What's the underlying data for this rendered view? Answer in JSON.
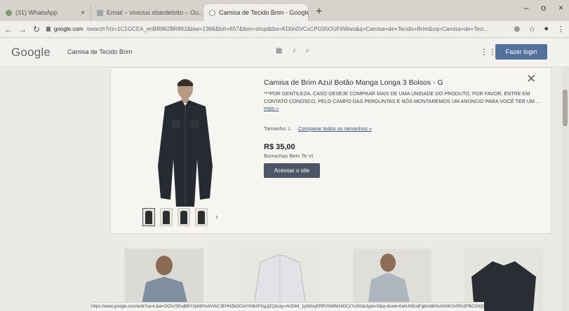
{
  "tabs": [
    {
      "label": "(31) WhatsApp",
      "close": "×"
    },
    {
      "label": "Email – vinicius sbardelotto – Ou...",
      "close": "×"
    },
    {
      "label": "Camisa de Tecido Brim - Google ...",
      "close": "×"
    }
  ],
  "new_tab_label": "+",
  "window_controls": {
    "minimize": "–",
    "maximize": "o",
    "close": "×"
  },
  "address": {
    "host": "google.com",
    "path": "/search?rlz=1C1GCEA_enBR862BR862&biw=1366&bih=657&tbm=shop&tbs=KD0n0VCxCPG95OUF6Wwo&q=Camisa+de+Tecido+Brim&oq=Camisa+de+Teci..."
  },
  "header": {
    "logo": "Google",
    "query": "Camisa de Tecido Brim",
    "login_label": "Fazer login"
  },
  "product": {
    "title": "Camisa de Brim Azul Botão Manga Longa 3 Bolsos - G",
    "description": "***POR GENTILEZA, CASO DESEJE COMPRAR MAIS DE UMA UNIDADE DO PRODUTO, POR FAVOR, ENTRE EM CONTATO CONOSCO, PELO CAMPO DAS PERGUNTAS E NÓS MONTAREMOS UM ANÚNCIO PARA VOCÊ TER UM ...",
    "more_label": "mais »",
    "size_label": "Tamanho: L",
    "compare_sizes": "Comparar todos os tamanhos »",
    "price": "R$ 35,00",
    "seller": "Borrachas Bem Te Vi",
    "visit_label": "Acessar o site"
  },
  "thumbnail_next": "›",
  "status_url": "https://www.google.com/aclk?sa=L&ai=DChcSEwjB6Y2pb8XnAhVkCJEHHZbOCkAYABAFGgJjZQ&sig=AOD64_1pN0oyERRVhb9MJ4OCzYu0G&ctype=5&q=&ved=0ahUKEwjFgbrnb8XnAhXlK2nSl%2FBCG9QQ"
}
